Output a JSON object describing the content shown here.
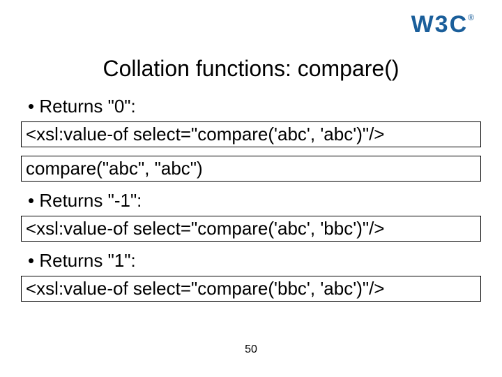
{
  "logo": {
    "name": "W3C"
  },
  "title": "Collation functions: compare()",
  "sections": [
    {
      "bullet": "Returns \"0\":",
      "code": "<xsl:value-of select=\"compare('abc', 'abc')\"/>"
    },
    {
      "code": "compare(\"abc\", \"abc\")"
    },
    {
      "bullet": "Returns \"-1\":",
      "code": "<xsl:value-of select=\"compare('abc', 'bbc')\"/>"
    },
    {
      "bullet": "Returns \"1\":",
      "code": "<xsl:value-of select=\"compare('bbc', 'abc')\"/>"
    }
  ],
  "page_number": "50"
}
